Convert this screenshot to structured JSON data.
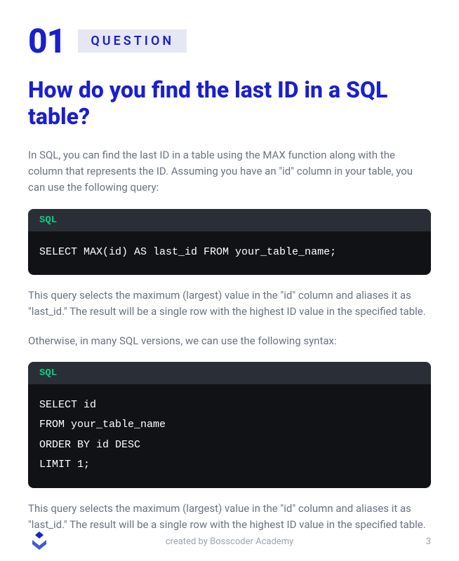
{
  "header": {
    "number": "01",
    "badge": "QUESTION"
  },
  "title": "How do you find the last ID in a SQL table?",
  "paragraphs": {
    "intro": "In SQL, you can find the last ID in a table using the MAX function along with the column that represents the ID. Assuming you have an \"id\" column in your table, you can use the following query:",
    "mid1": "This query selects the maximum (largest) value in the \"id\" column and aliases it as \"last_id.\" The result will be a single row with the highest ID value in the specified table.",
    "mid2": "Otherwise, in many SQL versions, we can use the following syntax:",
    "end": "This query selects the maximum (largest) value in the \"id\" column and aliases it as \"last_id.\" The result will be a single row with the highest ID value in the specified table."
  },
  "code1": {
    "lang": "SQL",
    "body": "SELECT MAX(id) AS last_id FROM your_table_name;"
  },
  "code2": {
    "lang": "SQL",
    "body": "SELECT id\nFROM your_table_name\nORDER BY id DESC\nLIMIT 1;"
  },
  "footer": {
    "credit": "created by Bosscoder Academy",
    "page": "3"
  }
}
